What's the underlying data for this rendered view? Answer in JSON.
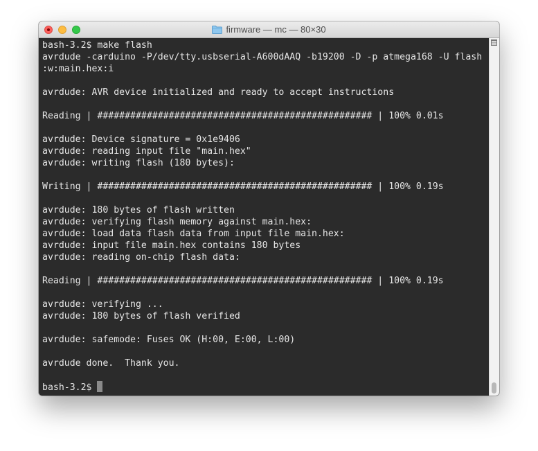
{
  "window": {
    "title": "firmware — mc — 80×30",
    "folder_icon": "folder-icon",
    "buttons": [
      "close",
      "minimize",
      "zoom"
    ]
  },
  "terminal": {
    "lines": [
      "bash-3.2$ make flash",
      "avrdude -carduino -P/dev/tty.usbserial-A600dAAQ -b19200 -D -p atmega168 -U flash",
      ":w:main.hex:i",
      "",
      "avrdude: AVR device initialized and ready to accept instructions",
      "",
      "Reading | ################################################## | 100% 0.01s",
      "",
      "avrdude: Device signature = 0x1e9406",
      "avrdude: reading input file \"main.hex\"",
      "avrdude: writing flash (180 bytes):",
      "",
      "Writing | ################################################## | 100% 0.19s",
      "",
      "avrdude: 180 bytes of flash written",
      "avrdude: verifying flash memory against main.hex:",
      "avrdude: load data flash data from input file main.hex:",
      "avrdude: input file main.hex contains 180 bytes",
      "avrdude: reading on-chip flash data:",
      "",
      "Reading | ################################################## | 100% 0.19s",
      "",
      "avrdude: verifying ...",
      "avrdude: 180 bytes of flash verified",
      "",
      "avrdude: safemode: Fuses OK (H:00, E:00, L:00)",
      "",
      "avrdude done.  Thank you.",
      ""
    ],
    "prompt": "bash-3.2$ ",
    "colors": {
      "background": "#2b2b2b",
      "foreground": "#e6e6e6",
      "cursor": "#8a8a8a"
    }
  },
  "scrollbar": {
    "menu_icon": "scrollback-menu-icon"
  }
}
